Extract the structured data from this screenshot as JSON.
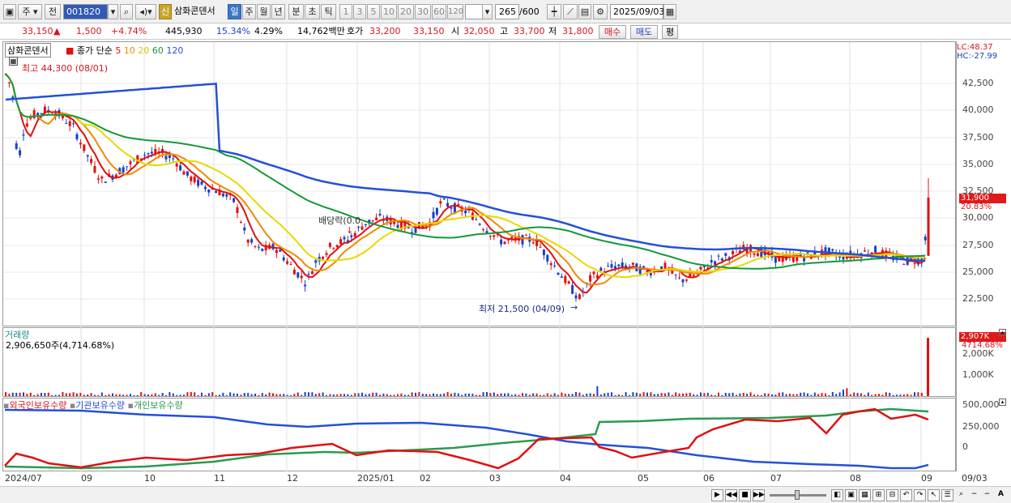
{
  "toolbar": {
    "period_type": "주",
    "prev_label": "전",
    "code": "001820",
    "shin_label": "신",
    "stock_name": "삼화콘덴서",
    "period_buttons": [
      "일",
      "주",
      "월",
      "년",
      "분",
      "초",
      "틱"
    ],
    "minute_buttons": [
      "1",
      "3",
      "5",
      "10",
      "20",
      "30",
      "60",
      "120"
    ],
    "count": "265",
    "count_max": "/600",
    "date": "2025/09/03"
  },
  "quote": {
    "price": "33,150",
    "change_arrow": "▲",
    "change": "1,500",
    "change_pct": "+4.74%",
    "volume": "445,930",
    "turnover_pct": "15.34%",
    "ratio_pct": "4.29%",
    "amount": "14,762백만",
    "ask_label": "호가",
    "ask1": "33,200",
    "ask2": "33,150",
    "open_label": "시",
    "open": "32,050",
    "high_label": "고",
    "high": "33,700",
    "low_label": "저",
    "low": "31,800",
    "buy_label": "매수",
    "sell_label": "매도",
    "eval_label": "평"
  },
  "price_pane": {
    "name_tag": "삼화콘덴서",
    "legend_prefix": "종가 단순",
    "ma_periods": [
      "5",
      "10",
      "20",
      "60",
      "120"
    ],
    "ma_colors": [
      "#e01010",
      "#f08a00",
      "#e8d800",
      "#129a38",
      "#2450d8"
    ],
    "high_note": "최고 44,300 (08/01)",
    "low_note": "최저 21,500 (04/09)",
    "dividend_note": "배당락(0.0",
    "lc": "LC:48.37",
    "hc": "HC:-27.99",
    "last_value": "31,900",
    "last_pct": "20.83%",
    "yticks": [
      "42,500",
      "40,000",
      "37,500",
      "35,000",
      "32,500",
      "30,000",
      "27,500",
      "25,000",
      "22,500"
    ]
  },
  "volume_pane": {
    "title": "거래량",
    "value": "2,906,650주(4,714.68%)",
    "last_value": "2,907K",
    "last_pct": "4714.68%",
    "yticks": [
      "2,000K",
      "1,000K"
    ]
  },
  "holdings_pane": {
    "legend": [
      "외국인보유수량",
      "기관보유수량",
      "개인보유수량"
    ],
    "colors": [
      "#e01010",
      "#2450d8",
      "#2a9a50"
    ],
    "yticks": [
      "500,000",
      "250,000",
      "0"
    ]
  },
  "x_axis": [
    "2024/07",
    "09",
    "10",
    "11",
    "12",
    "2025/01",
    "02",
    "03",
    "04",
    "05",
    "06",
    "07",
    "08",
    "09",
    "09/03"
  ]
}
